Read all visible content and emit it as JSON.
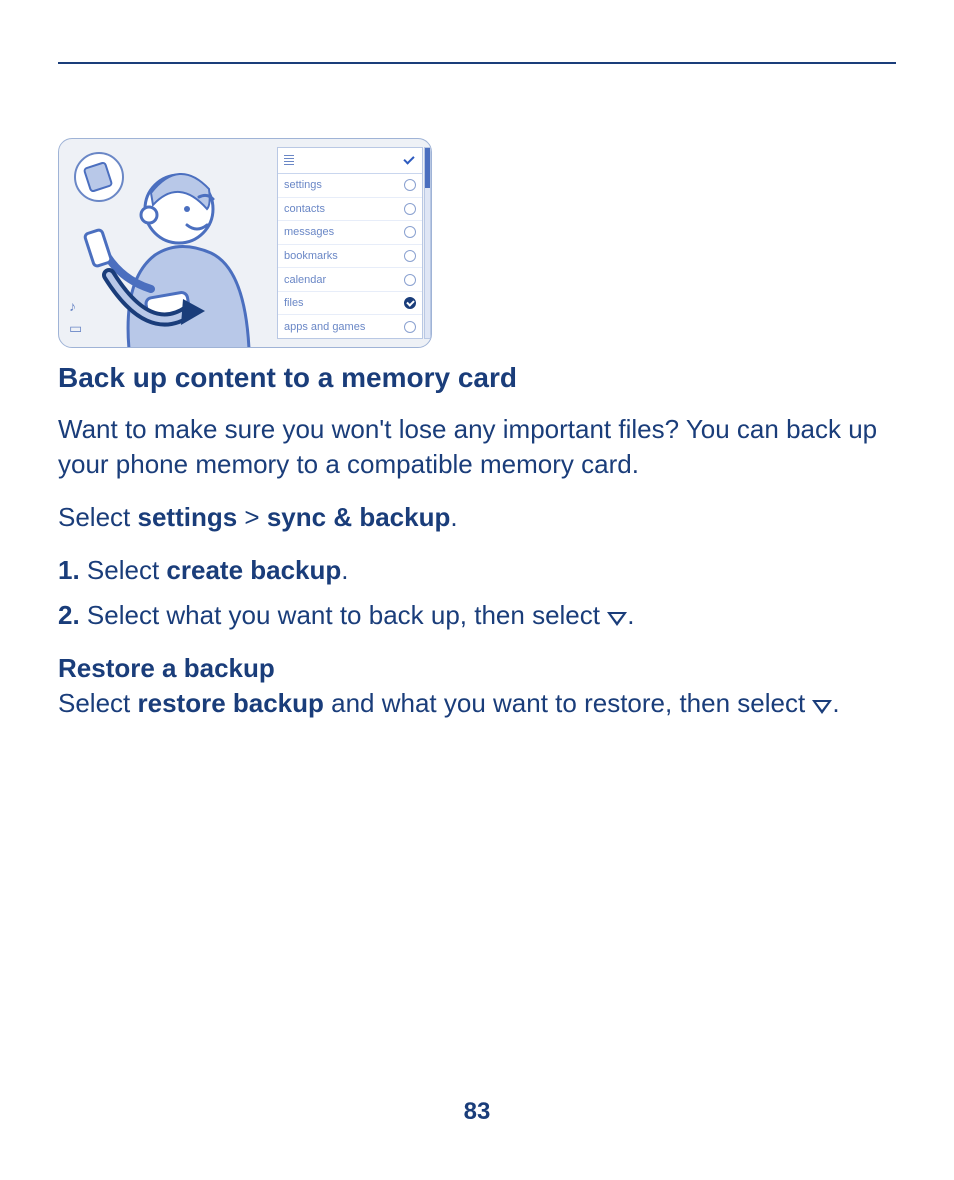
{
  "page_number": "83",
  "illustration": {
    "list_items": [
      {
        "label": "settings",
        "checked": false
      },
      {
        "label": "contacts",
        "checked": false
      },
      {
        "label": "messages",
        "checked": false
      },
      {
        "label": "bookmarks",
        "checked": false
      },
      {
        "label": "calendar",
        "checked": false
      },
      {
        "label": "files",
        "checked": true
      },
      {
        "label": "apps and games",
        "checked": false
      }
    ]
  },
  "section": {
    "title": "Back up content to a memory card",
    "intro": "Want to make sure you won't lose any important files? You can back up your phone memory to a compatible memory card.",
    "nav_prefix": "Select ",
    "nav_item1": "settings",
    "nav_sep": " > ",
    "nav_item2": "sync & backup",
    "nav_suffix": ".",
    "steps": [
      {
        "n": "1.",
        "pre": " Select ",
        "bold": "create backup",
        "post": "."
      },
      {
        "n": "2.",
        "pre": " Select what you want to back up, then select ",
        "bold": "",
        "post": "."
      }
    ],
    "sub_title": "Restore a backup",
    "restore_pre": "Select ",
    "restore_bold": "restore backup",
    "restore_mid": " and what you want to restore, then select ",
    "restore_post": "."
  }
}
